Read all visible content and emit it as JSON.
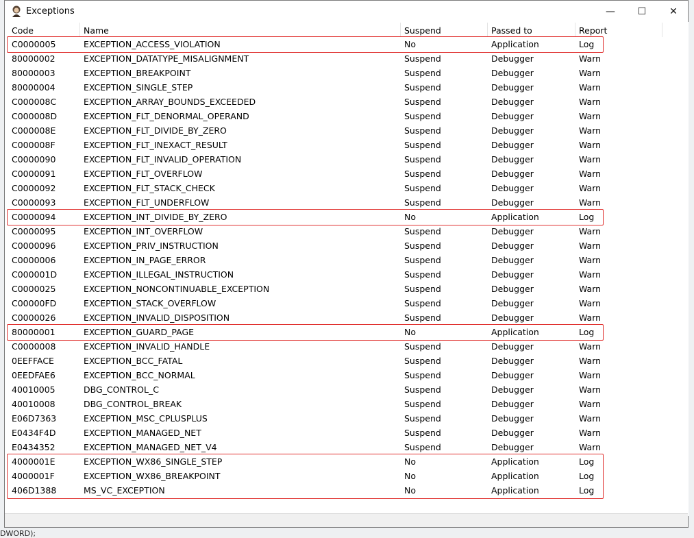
{
  "window": {
    "title": "Exceptions",
    "controls": {
      "minimize": "—",
      "maximize": "☐",
      "close": "✕"
    }
  },
  "background": {
    "bottom_text": "DWORD);"
  },
  "columns": [
    "Code",
    "Name",
    "Suspend",
    "Passed to",
    "Report"
  ],
  "rows": [
    {
      "code": "C0000005",
      "name": "EXCEPTION_ACCESS_VIOLATION",
      "suspend": "No",
      "passed_to": "Application",
      "report": "Log"
    },
    {
      "code": "80000002",
      "name": "EXCEPTION_DATATYPE_MISALIGNMENT",
      "suspend": "Suspend",
      "passed_to": "Debugger",
      "report": "Warn"
    },
    {
      "code": "80000003",
      "name": "EXCEPTION_BREAKPOINT",
      "suspend": "Suspend",
      "passed_to": "Debugger",
      "report": "Warn"
    },
    {
      "code": "80000004",
      "name": "EXCEPTION_SINGLE_STEP",
      "suspend": "Suspend",
      "passed_to": "Debugger",
      "report": "Warn"
    },
    {
      "code": "C000008C",
      "name": "EXCEPTION_ARRAY_BOUNDS_EXCEEDED",
      "suspend": "Suspend",
      "passed_to": "Debugger",
      "report": "Warn"
    },
    {
      "code": "C000008D",
      "name": "EXCEPTION_FLT_DENORMAL_OPERAND",
      "suspend": "Suspend",
      "passed_to": "Debugger",
      "report": "Warn"
    },
    {
      "code": "C000008E",
      "name": "EXCEPTION_FLT_DIVIDE_BY_ZERO",
      "suspend": "Suspend",
      "passed_to": "Debugger",
      "report": "Warn"
    },
    {
      "code": "C000008F",
      "name": "EXCEPTION_FLT_INEXACT_RESULT",
      "suspend": "Suspend",
      "passed_to": "Debugger",
      "report": "Warn"
    },
    {
      "code": "C0000090",
      "name": "EXCEPTION_FLT_INVALID_OPERATION",
      "suspend": "Suspend",
      "passed_to": "Debugger",
      "report": "Warn"
    },
    {
      "code": "C0000091",
      "name": "EXCEPTION_FLT_OVERFLOW",
      "suspend": "Suspend",
      "passed_to": "Debugger",
      "report": "Warn"
    },
    {
      "code": "C0000092",
      "name": "EXCEPTION_FLT_STACK_CHECK",
      "suspend": "Suspend",
      "passed_to": "Debugger",
      "report": "Warn"
    },
    {
      "code": "C0000093",
      "name": "EXCEPTION_FLT_UNDERFLOW",
      "suspend": "Suspend",
      "passed_to": "Debugger",
      "report": "Warn"
    },
    {
      "code": "C0000094",
      "name": "EXCEPTION_INT_DIVIDE_BY_ZERO",
      "suspend": "No",
      "passed_to": "Application",
      "report": "Log"
    },
    {
      "code": "C0000095",
      "name": "EXCEPTION_INT_OVERFLOW",
      "suspend": "Suspend",
      "passed_to": "Debugger",
      "report": "Warn"
    },
    {
      "code": "C0000096",
      "name": "EXCEPTION_PRIV_INSTRUCTION",
      "suspend": "Suspend",
      "passed_to": "Debugger",
      "report": "Warn"
    },
    {
      "code": "C0000006",
      "name": "EXCEPTION_IN_PAGE_ERROR",
      "suspend": "Suspend",
      "passed_to": "Debugger",
      "report": "Warn"
    },
    {
      "code": "C000001D",
      "name": "EXCEPTION_ILLEGAL_INSTRUCTION",
      "suspend": "Suspend",
      "passed_to": "Debugger",
      "report": "Warn"
    },
    {
      "code": "C0000025",
      "name": "EXCEPTION_NONCONTINUABLE_EXCEPTION",
      "suspend": "Suspend",
      "passed_to": "Debugger",
      "report": "Warn"
    },
    {
      "code": "C00000FD",
      "name": "EXCEPTION_STACK_OVERFLOW",
      "suspend": "Suspend",
      "passed_to": "Debugger",
      "report": "Warn"
    },
    {
      "code": "C0000026",
      "name": "EXCEPTION_INVALID_DISPOSITION",
      "suspend": "Suspend",
      "passed_to": "Debugger",
      "report": "Warn"
    },
    {
      "code": "80000001",
      "name": "EXCEPTION_GUARD_PAGE",
      "suspend": "No",
      "passed_to": "Application",
      "report": "Log"
    },
    {
      "code": "C0000008",
      "name": "EXCEPTION_INVALID_HANDLE",
      "suspend": "Suspend",
      "passed_to": "Debugger",
      "report": "Warn"
    },
    {
      "code": "0EEFFACE",
      "name": "EXCEPTION_BCC_FATAL",
      "suspend": "Suspend",
      "passed_to": "Debugger",
      "report": "Warn"
    },
    {
      "code": "0EEDFAE6",
      "name": "EXCEPTION_BCC_NORMAL",
      "suspend": "Suspend",
      "passed_to": "Debugger",
      "report": "Warn"
    },
    {
      "code": "40010005",
      "name": "DBG_CONTROL_C",
      "suspend": "Suspend",
      "passed_to": "Debugger",
      "report": "Warn"
    },
    {
      "code": "40010008",
      "name": "DBG_CONTROL_BREAK",
      "suspend": "Suspend",
      "passed_to": "Debugger",
      "report": "Warn"
    },
    {
      "code": "E06D7363",
      "name": "EXCEPTION_MSC_CPLUSPLUS",
      "suspend": "Suspend",
      "passed_to": "Debugger",
      "report": "Warn"
    },
    {
      "code": "E0434F4D",
      "name": "EXCEPTION_MANAGED_NET",
      "suspend": "Suspend",
      "passed_to": "Debugger",
      "report": "Warn"
    },
    {
      "code": "E0434352",
      "name": "EXCEPTION_MANAGED_NET_V4",
      "suspend": "Suspend",
      "passed_to": "Debugger",
      "report": "Warn"
    },
    {
      "code": "4000001E",
      "name": "EXCEPTION_WX86_SINGLE_STEP",
      "suspend": "No",
      "passed_to": "Application",
      "report": "Log"
    },
    {
      "code": "4000001F",
      "name": "EXCEPTION_WX86_BREAKPOINT",
      "suspend": "No",
      "passed_to": "Application",
      "report": "Log"
    },
    {
      "code": "406D1388",
      "name": "MS_VC_EXCEPTION",
      "suspend": "No",
      "passed_to": "Application",
      "report": "Log"
    }
  ],
  "highlight_color": "#e0302e"
}
